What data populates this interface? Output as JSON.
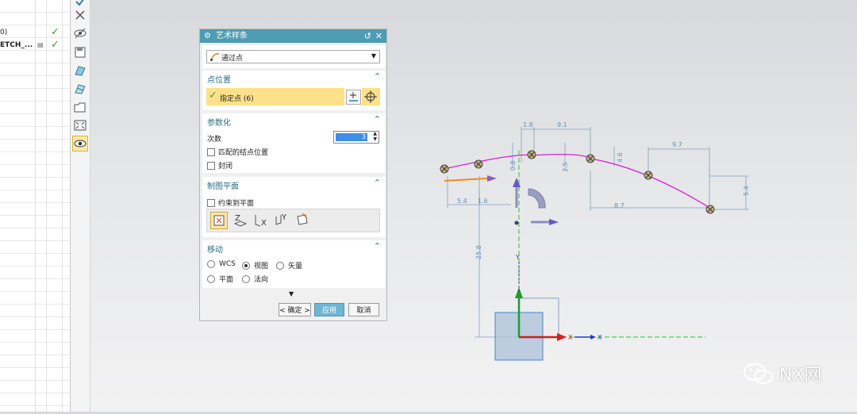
{
  "navigator": {
    "rows": [
      {
        "label": "0)",
        "extra": "",
        "check": "✓"
      },
      {
        "label": "ETCH_...",
        "extra": "",
        "check": "✓"
      }
    ]
  },
  "toolbar": {
    "icons": [
      "check-icon",
      "close-x-icon",
      "hide-eye-icon",
      "save-icon",
      "surface-icon",
      "surface-edit-icon",
      "folder-icon",
      "fit-view-icon",
      "show-eye-icon"
    ]
  },
  "dialog": {
    "title": "艺术样条",
    "reset_symbol": "↺",
    "close_symbol": "✕",
    "type_select": "通过点",
    "point_section": {
      "title": "点位置",
      "specify_label": "指定点 (6)"
    },
    "param_section": {
      "title": "参数化",
      "degree_label": "次数",
      "degree_value": "3",
      "match_knots_label": "匹配的结点位置",
      "closed_label": "封闭"
    },
    "plane_section": {
      "title": "制图平面",
      "constrain_label": "约束到平面"
    },
    "move_section": {
      "title": "移动",
      "options": [
        "WCS",
        "视图",
        "矢量",
        "平面",
        "法向"
      ],
      "selected": "视图"
    },
    "buttons": {
      "ok": "< 确定 >",
      "apply": "应用",
      "cancel": "取消"
    }
  },
  "canvas": {
    "dimensions": [
      "1.8",
      "9.1",
      "9.7",
      "0.8",
      "2.5",
      "4.6",
      "5.4",
      "1.6",
      "8.7",
      "5.4",
      "25.8"
    ],
    "axis_labels": [
      "X",
      "Y",
      "X"
    ],
    "colors": {
      "spline": "#d91ed9",
      "dimension": "#6a8fb5",
      "axis_x": "#d42020",
      "axis_y": "#1e9d2b",
      "axis_z": "#1f3dbb",
      "centerline": "#1bd11b"
    }
  },
  "watermark": {
    "text": "NX网"
  }
}
